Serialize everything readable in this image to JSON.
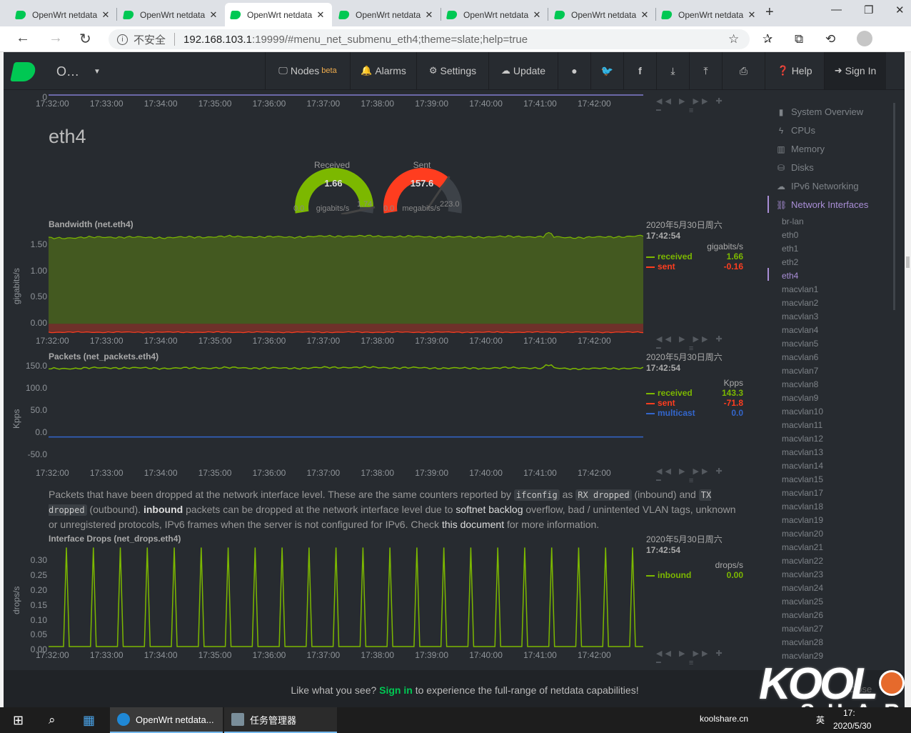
{
  "browser": {
    "tabs": [
      {
        "title": "OpenWrt netdata",
        "active": false
      },
      {
        "title": "OpenWrt netdata",
        "active": false
      },
      {
        "title": "OpenWrt netdata",
        "active": true
      },
      {
        "title": "OpenWrt netdata",
        "active": false
      },
      {
        "title": "OpenWrt netdata",
        "active": false
      },
      {
        "title": "OpenWrt netdata",
        "active": false
      },
      {
        "title": "OpenWrt netdata",
        "active": false
      }
    ],
    "security_label": "不安全",
    "url_host": "192.168.103.1",
    "url_rest": ":19999/#menu_net_submenu_eth4;theme=slate;help=true"
  },
  "navbar": {
    "brand": "O…",
    "nodes": "Nodes",
    "nodes_badge": "beta",
    "alarms": "Alarms",
    "settings": "Settings",
    "update": "Update",
    "help": "Help",
    "signin": "Sign In"
  },
  "section": {
    "heading": "eth4"
  },
  "time_ticks": [
    "17:32:00",
    "17:33:00",
    "17:34:00",
    "17:35:00",
    "17:36:00",
    "17:37:00",
    "17:38:00",
    "17:39:00",
    "17:40:00",
    "17:41:00",
    "17:42:00"
  ],
  "gauges": {
    "received": {
      "title": "Received",
      "value": "1.66",
      "unit": "gigabits/s",
      "min": "0.0",
      "max": "1.74",
      "fraction": 0.954,
      "color": "#7cb800"
    },
    "sent": {
      "title": "Sent",
      "value": "157.6",
      "unit": "megabits/s",
      "min": "0.0",
      "max": "223.0",
      "fraction": 0.707,
      "color": "#ff3d1f"
    }
  },
  "colors": {
    "received": "#7cb800",
    "sent": "#ff3d1f",
    "multicast": "#3366cc",
    "accent": "#a98ed6",
    "brand": "#00c853"
  },
  "description": {
    "p1": "Packets that have been dropped at the network interface level. These are the same counters reported by",
    "code1": "ifconfig",
    "p2": "as",
    "code2": "RX dropped",
    "p3": "(inbound) and",
    "code3": "TX dropped",
    "p4": "(outbound).",
    "b1": "inbound",
    "p5": "packets can be dropped at the network interface level due to",
    "link1": "softnet backlog",
    "p6": "overflow, bad / unintented VLAN tags, unknown or unregistered protocols, IPv6 frames when the server is not configured for IPv6. Check",
    "link2": "this document",
    "p7": "for more information."
  },
  "chart_data": [
    {
      "type": "area",
      "title": "Bandwidth (net.eth4)",
      "ylabel": "gigabits/s",
      "yticks": [
        "1.50",
        "1.00",
        "0.50",
        "0.00"
      ],
      "ylim": [
        -0.2,
        1.8
      ],
      "x": [
        "17:32:00",
        "17:33:00",
        "17:34:00",
        "17:35:00",
        "17:36:00",
        "17:37:00",
        "17:38:00",
        "17:39:00",
        "17:40:00",
        "17:41:00",
        "17:42:00"
      ],
      "series": [
        {
          "name": "received",
          "values": [
            1.62,
            1.64,
            1.63,
            1.65,
            1.64,
            1.66,
            1.65,
            1.64,
            1.65,
            1.63,
            1.66
          ],
          "display": "1.66"
        },
        {
          "name": "sent",
          "values": [
            -0.16,
            -0.16,
            -0.16,
            -0.16,
            -0.16,
            -0.16,
            -0.16,
            -0.16,
            -0.16,
            -0.16,
            -0.16
          ],
          "display": "-0.16"
        }
      ],
      "legend": {
        "date": "2020年5月30日周六",
        "time": "17:42:54",
        "units": "gigabits/s"
      }
    },
    {
      "type": "line",
      "title": "Packets (net_packets.eth4)",
      "ylabel": "Kpps",
      "yticks": [
        "150.0",
        "100.0",
        "50.0",
        "0.0",
        "-50.0"
      ],
      "ylim": [
        -60,
        160
      ],
      "x": [
        "17:32:00",
        "17:33:00",
        "17:34:00",
        "17:35:00",
        "17:36:00",
        "17:37:00",
        "17:38:00",
        "17:39:00",
        "17:40:00",
        "17:41:00",
        "17:42:00"
      ],
      "series": [
        {
          "name": "received",
          "values": [
            142,
            144,
            143,
            144,
            143,
            145,
            144,
            143,
            144,
            142,
            143.3
          ],
          "display": "143.3"
        },
        {
          "name": "sent",
          "values": [
            -70,
            -72,
            -71,
            -72,
            -71,
            -73,
            -72,
            -71,
            -72,
            -70,
            -71.8
          ],
          "display": "-71.8"
        },
        {
          "name": "multicast",
          "values": [
            0,
            0,
            0,
            0,
            0,
            0,
            0,
            0,
            0,
            0,
            0
          ],
          "display": "0.0"
        }
      ],
      "legend": {
        "date": "2020年5月30日周六",
        "time": "17:42:54",
        "units": "Kpps"
      }
    },
    {
      "type": "line",
      "title": "Interface Drops (net_drops.eth4)",
      "ylabel": "drops/s",
      "yticks": [
        "0.30",
        "0.25",
        "0.20",
        "0.15",
        "0.10",
        "0.05",
        "0.00"
      ],
      "ylim": [
        0,
        0.35
      ],
      "x": [
        "17:32:00",
        "17:33:00",
        "17:34:00",
        "17:35:00",
        "17:36:00",
        "17:37:00",
        "17:38:00",
        "17:39:00",
        "17:40:00",
        "17:41:00",
        "17:42:00"
      ],
      "spike_count": 22,
      "spike_value": 0.33,
      "series": [
        {
          "name": "inbound",
          "values": [
            0,
            0,
            0,
            0,
            0,
            0,
            0,
            0,
            0,
            0,
            0
          ],
          "display": "0.00"
        }
      ],
      "legend": {
        "date": "2020年5月30日周六",
        "time": "17:42:54",
        "units": "drops/s"
      }
    }
  ],
  "sidebar": {
    "items": [
      {
        "label": "System Overview",
        "icon": "bookmark-icon"
      },
      {
        "label": "CPUs",
        "icon": "bolt-icon"
      },
      {
        "label": "Memory",
        "icon": "memory-icon"
      },
      {
        "label": "Disks",
        "icon": "hdd-icon"
      },
      {
        "label": "IPv6 Networking",
        "icon": "cloud-icon"
      },
      {
        "label": "Network Interfaces",
        "icon": "sitemap-icon"
      }
    ],
    "subitems": [
      "br-lan",
      "eth0",
      "eth1",
      "eth2",
      "eth4",
      "macvlan1",
      "macvlan2",
      "macvlan3",
      "macvlan4",
      "macvlan5",
      "macvlan6",
      "macvlan7",
      "macvlan8",
      "macvlan9",
      "macvlan10",
      "macvlan11",
      "macvlan12",
      "macvlan13",
      "macvlan14",
      "macvlan15",
      "macvlan17",
      "macvlan18",
      "macvlan19",
      "macvlan20",
      "macvlan21",
      "macvlan22",
      "macvlan23",
      "macvlan24",
      "macvlan25",
      "macvlan26",
      "macvlan27",
      "macvlan28",
      "macvlan29"
    ]
  },
  "footer": {
    "pre": "Like what you see?",
    "link": "Sign in",
    "post": "to experience the full-range of netdata capabilities!",
    "close": "Close"
  },
  "taskbar": {
    "app1": "OpenWrt netdata...",
    "app2": "任务管理器",
    "site": "koolshare.cn",
    "ime": "英",
    "time": "17:",
    "date": "2020/5/30"
  }
}
